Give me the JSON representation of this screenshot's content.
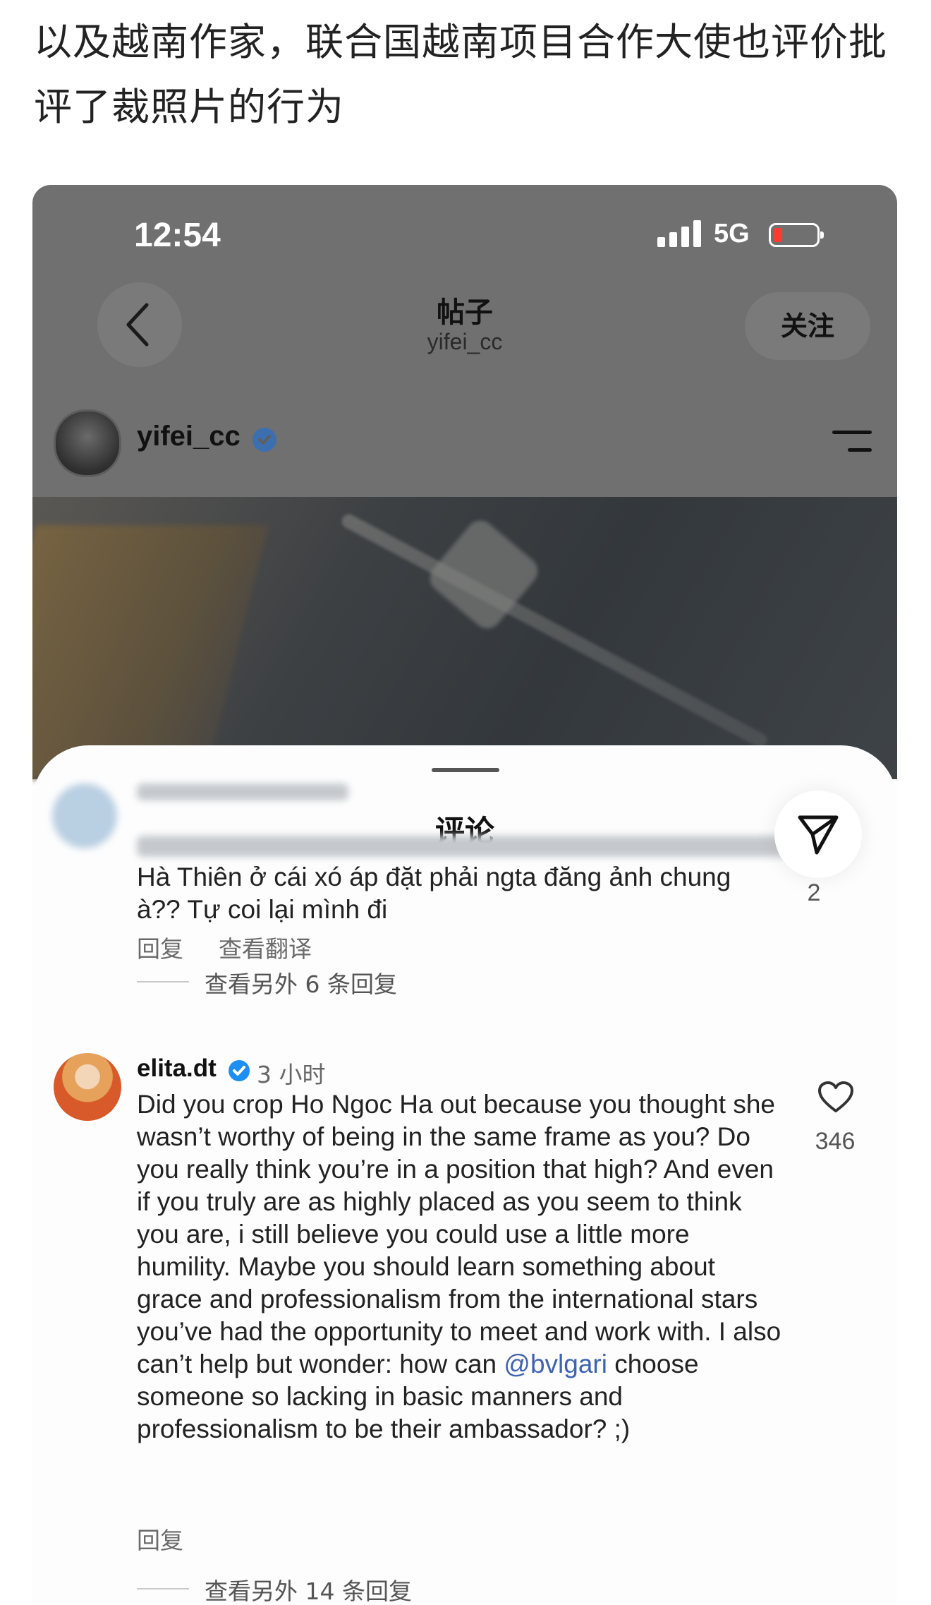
{
  "caption": "以及越南作家，联合国越南项目合作大使也评价批评了裁照片的行为",
  "status_bar": {
    "time": "12:54",
    "network": "5G"
  },
  "nav": {
    "title": "帖子",
    "subtitle": "yifei_cc",
    "follow": "关注"
  },
  "post": {
    "username": "yifei_cc"
  },
  "sheet": {
    "title": "评论"
  },
  "comments": [
    {
      "text": "Hà Thiên ở cái xó áp đặt phải ngta đăng ảnh chung à?? Tự coi lại mình đi",
      "reply": "回复",
      "translate": "查看翻译",
      "like_count": "2",
      "more_replies": "查看另外 6 条回复"
    },
    {
      "username": "elita.dt",
      "time": "3 小时",
      "text_before": "Did you crop Ho Ngoc Ha out because you thought she wasn’t worthy of being in the same frame as you? Do you really think you’re in a position that high? And even if you truly are as highly placed as you seem to think you are, i still believe you could use a little more humility. Maybe you should learn something about grace and professionalism from the international stars you’ve had the opportunity to meet and work with. I also can’t help but wonder: how can ",
      "mention": "@bvlgari",
      "text_after": " choose someone so lacking in basic manners and professionalism to be their ambassador? ;)",
      "reply": "回复",
      "like_count": "346",
      "more_replies": "查看另外 14 条回复"
    }
  ],
  "colors": {
    "mention": "#3f63b4",
    "verified": "#1d8ef2"
  }
}
